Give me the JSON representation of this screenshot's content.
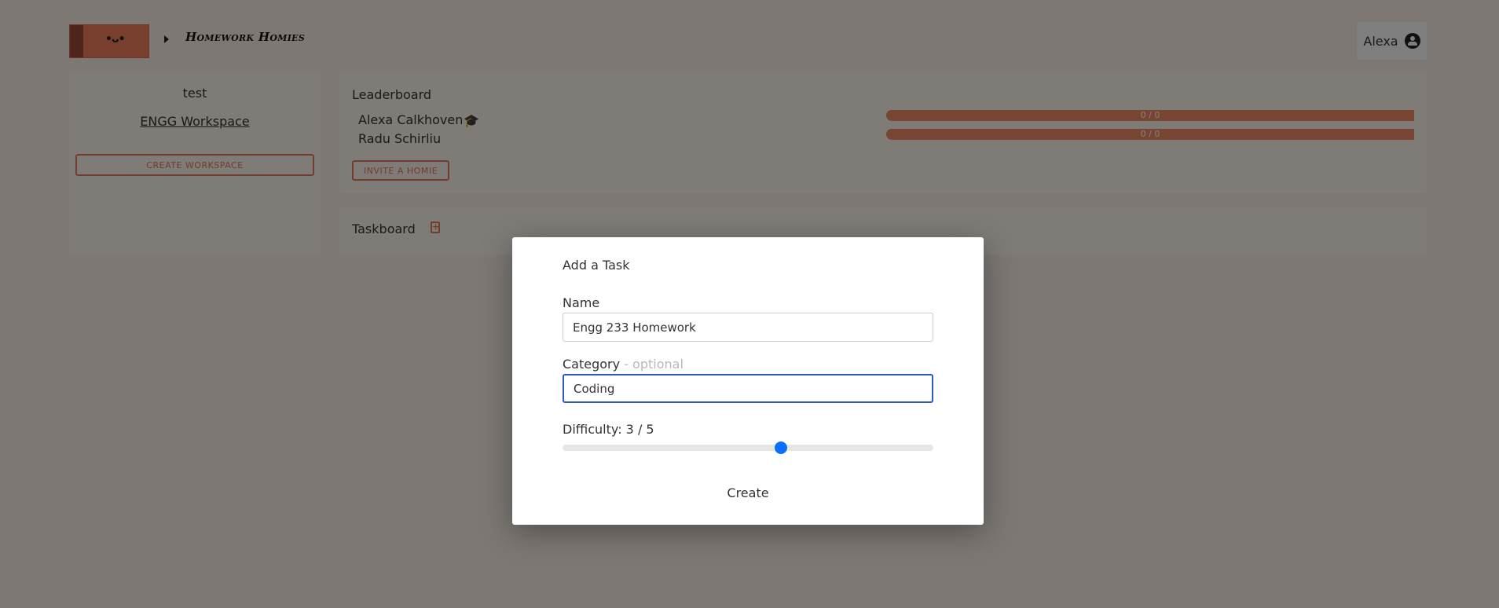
{
  "header": {
    "logo_face": "•ᴗ•",
    "app_title": "Homework Homies",
    "user_name": "Alexa"
  },
  "sidebar": {
    "workspace_title": "test",
    "workspace_link": "ENGG Workspace",
    "create_workspace_label": "CREATE WORKSPACE"
  },
  "leaderboard": {
    "title": "Leaderboard",
    "rows": [
      {
        "name": "Alexa Calkhoven",
        "progress_text": "0 / 0"
      },
      {
        "name": "Radu Schirliu",
        "progress_text": "0 / 0"
      }
    ],
    "invite_label": "INVITE A HOMIE"
  },
  "taskboard": {
    "title": "Taskboard"
  },
  "modal": {
    "title": "Add a Task",
    "name_label": "Name",
    "name_value": "Engg 233 Homework",
    "category_label": "Category",
    "category_optional": "- optional",
    "category_value": "Coding",
    "difficulty_label": "Difficulty: 3 / 5",
    "difficulty_value": 3,
    "difficulty_max": 5,
    "create_label": "Create"
  },
  "colors": {
    "accent": "#e07a5a",
    "focus": "#2b57c8",
    "slider": "#0d6efd"
  }
}
